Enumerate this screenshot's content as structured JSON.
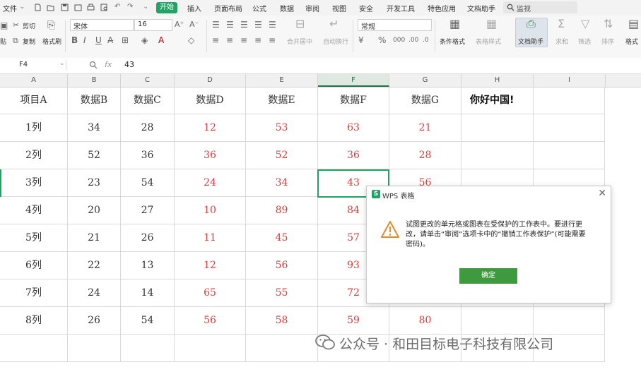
{
  "menubar": {
    "file": "文件",
    "tabs": [
      "开始",
      "插入",
      "页面布局",
      "公式",
      "数据",
      "审阅",
      "视图",
      "安全",
      "开发工具",
      "特色应用",
      "文档助手"
    ],
    "search_placeholder": "监视",
    "accent": "#21a366"
  },
  "ribbon": {
    "cut": "剪切",
    "copy": "复制",
    "paste_tail": "贴",
    "format_painter": "格式刷",
    "font_name": "宋体",
    "font_size": "16",
    "merge": "合并居中",
    "wrap": "自动换行",
    "number_format": "常规",
    "conditional_format": "条件格式",
    "table_style": "表格样式",
    "doc_assistant": "文档助手",
    "sum": "求和",
    "filter": "筛选",
    "sort": "排序",
    "format_tail": "格式"
  },
  "formula_bar": {
    "cell_ref": "F4",
    "fx": "fx",
    "value": "43"
  },
  "columns": [
    "A",
    "B",
    "C",
    "D",
    "E",
    "F",
    "G",
    "H",
    "I"
  ],
  "grid": {
    "header": [
      "项目A",
      "数据B",
      "数据C",
      "数据D",
      "数据E",
      "数据F",
      "数据G",
      "你好中国!"
    ],
    "rows": [
      [
        "1列",
        "34",
        "28",
        "12",
        "53",
        "63",
        "21"
      ],
      [
        "2列",
        "52",
        "36",
        "36",
        "52",
        "36",
        "28"
      ],
      [
        "3列",
        "23",
        "54",
        "24",
        "34",
        "43",
        "56"
      ],
      [
        "4列",
        "20",
        "27",
        "10",
        "89",
        "84",
        ""
      ],
      [
        "5列",
        "21",
        "26",
        "11",
        "45",
        "57",
        ""
      ],
      [
        "6列",
        "22",
        "13",
        "12",
        "56",
        "93",
        ""
      ],
      [
        "7列",
        "24",
        "14",
        "65",
        "55",
        "72",
        ""
      ],
      [
        "8列",
        "26",
        "54",
        "56",
        "58",
        "59",
        "80"
      ]
    ],
    "value_color_red": "#e23b3b"
  },
  "dialog": {
    "title": "WPS 表格",
    "message": "试图更改的单元格或图表在受保护的工作表中。要进行更改，请单击“审阅”选项卡中的“撤销工作表保护”(可能需要密码)。",
    "ok": "确定",
    "ok_color": "#3f9a3f"
  },
  "watermark": {
    "text": "公众号 · 和田目标电子科技有限公司"
  }
}
